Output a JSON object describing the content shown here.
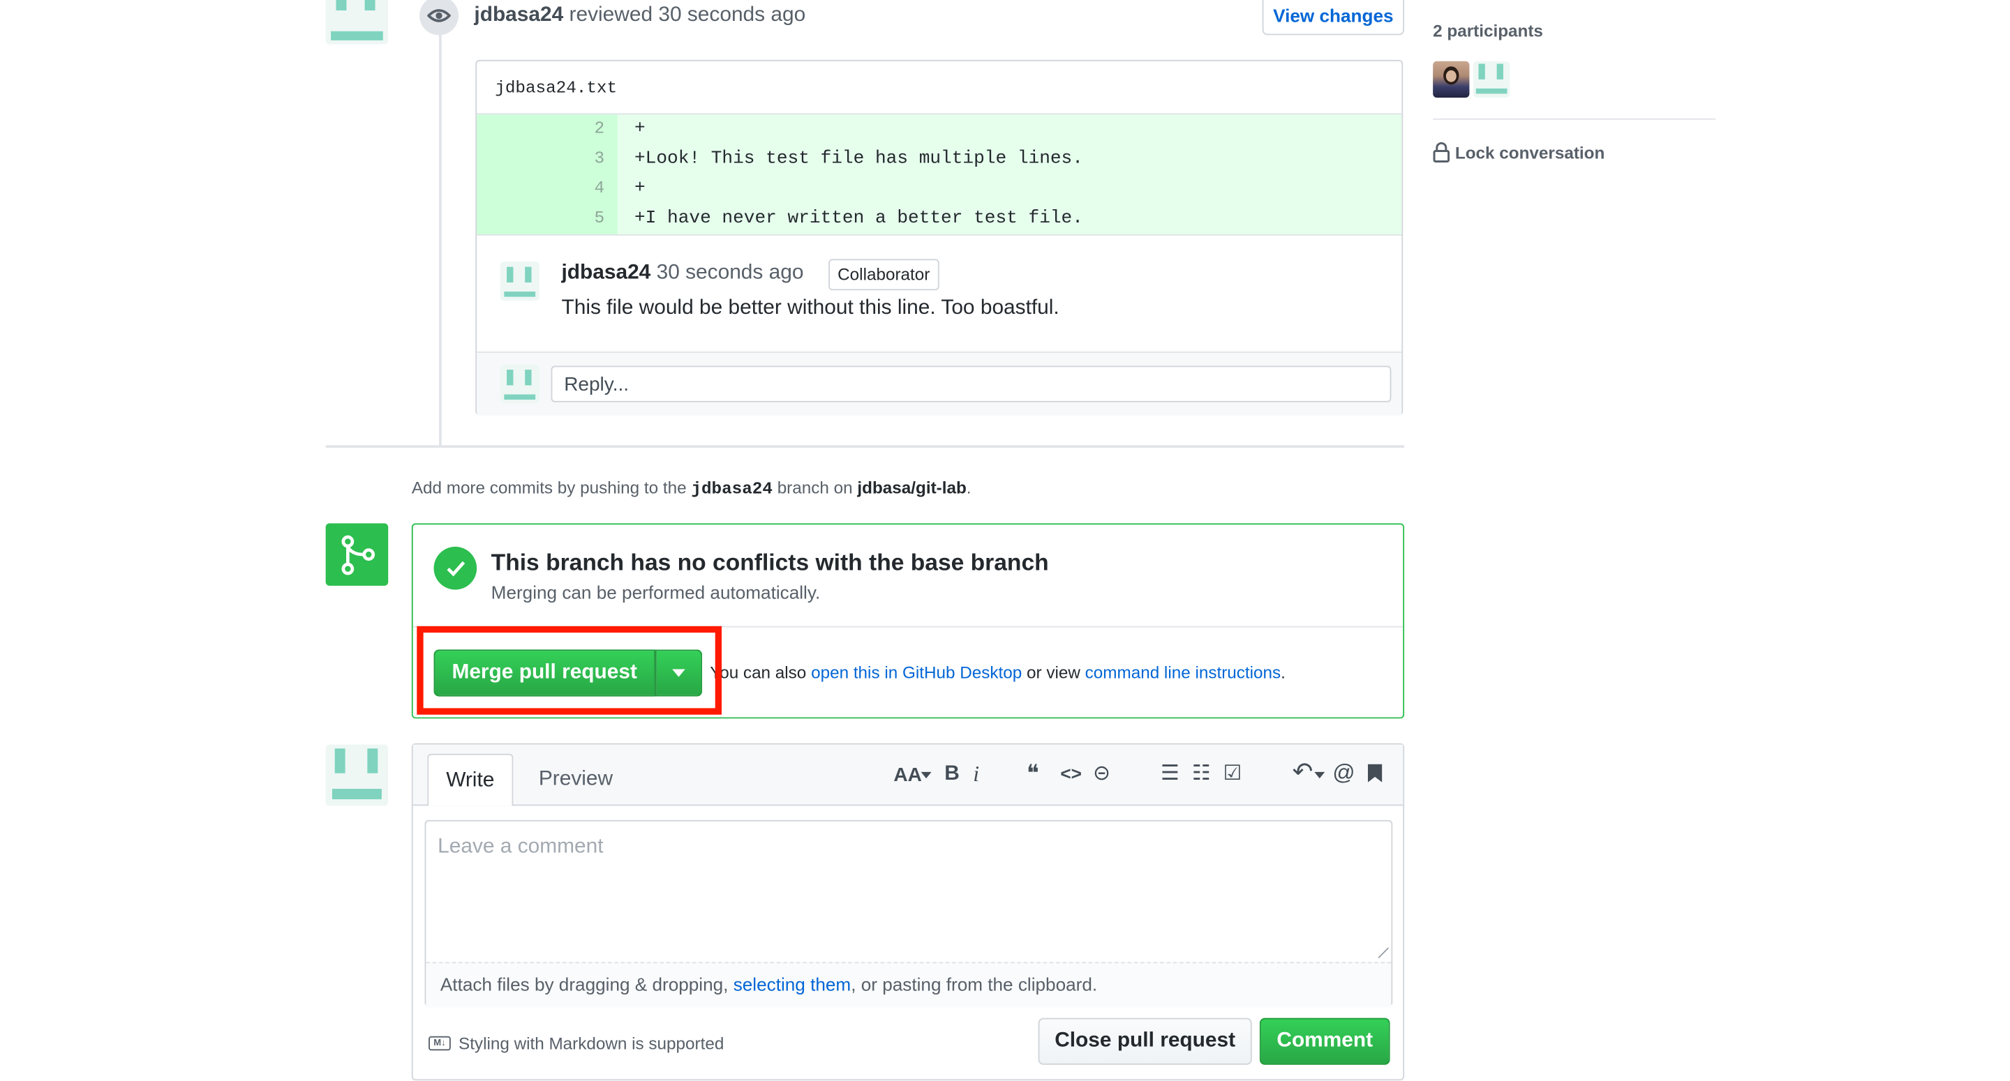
{
  "review": {
    "reviewer": "jdbasa24",
    "action_text": "reviewed 30 seconds ago",
    "view_changes_label": "View changes",
    "file_name": "jdbasa24.txt",
    "diff_lines": [
      {
        "num": "2",
        "code": "+"
      },
      {
        "num": "3",
        "code": "+Look! This test file has multiple lines."
      },
      {
        "num": "4",
        "code": "+"
      },
      {
        "num": "5",
        "code": "+I have never written a better test file."
      }
    ],
    "comment": {
      "author": "jdbasa24",
      "time": "30 seconds ago",
      "badge": "Collaborator",
      "body": "This file would be better without this line. Too boastful."
    },
    "reply_placeholder": "Reply..."
  },
  "sidebar": {
    "participants_label": "2 participants",
    "lock_label": "Lock conversation"
  },
  "commits_hint": {
    "prefix": "Add more commits by pushing to the",
    "branch": "jdbasa24",
    "middle": "branch on",
    "repo": "jdbasa/git-lab",
    "suffix": "."
  },
  "merge": {
    "title": "This branch has no conflicts with the base branch",
    "subtitle": "Merging can be performed automatically.",
    "button_label": "Merge pull request",
    "alt_prefix": "You can also",
    "desktop_link": "open this in GitHub Desktop",
    "alt_middle": "or view",
    "cli_link": "command line instructions",
    "alt_suffix": ".",
    "highlight_color": "#ff1a00"
  },
  "composer": {
    "tab_write": "Write",
    "tab_preview": "Preview",
    "placeholder": "Leave a comment",
    "attach_prefix": "Attach files by dragging & dropping,",
    "attach_link": "selecting them",
    "attach_suffix": ", or pasting from the clipboard.",
    "markdown_note": "Styling with Markdown is supported",
    "close_label": "Close pull request",
    "comment_label": "Comment",
    "toolbar": {
      "text_size": "AA",
      "bold": "B",
      "italic": "i",
      "quote": "❝",
      "code": "<>",
      "link": "⊝",
      "bullets": "☰",
      "numbered": "☷",
      "tasks": "☑",
      "reply": "↶",
      "mention": "@",
      "bookmark": "◼"
    }
  },
  "colors": {
    "accent_green": "#2cbe4e",
    "diff_added_bg": "#e6ffed",
    "link_blue": "#0366d6",
    "avatar_teal": "#7fd3bf"
  }
}
